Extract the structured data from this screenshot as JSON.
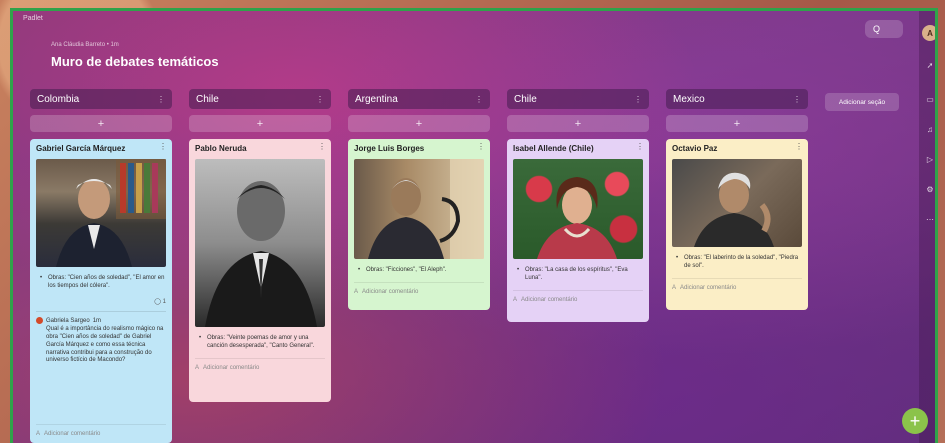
{
  "app": {
    "name": "Padlet"
  },
  "wall": {
    "author_line": "Ana Cláudia Barreto • 1m",
    "title": "Muro de debates temáticos"
  },
  "toolbar": {
    "search_label": "Q"
  },
  "add_section_label": "Adicionar seção",
  "add_post_symbol": "+",
  "comment_placeholder": "Adicionar comentário",
  "columns": [
    {
      "name": "Colombia",
      "card": {
        "title": "Gabriel García Márquez",
        "bullet": "Obras: \"Cien años de soledad\", \"El amor en los tiempos del cólera\".",
        "reaction_count": "1",
        "reply": {
          "author": "Gabriela Sargeo",
          "time": "1m",
          "text": "Qual é a importância do realismo mágico na obra \"Cien años de soledad\" de Gabriel García Márquez e como essa técnica narrativa contribui para a construção do universo fictício de Macondo?"
        }
      }
    },
    {
      "name": "Chile",
      "card": {
        "title": "Pablo Neruda",
        "bullet": "Obras: \"Veinte poemas de amor y una canción desesperada\", \"Canto General\"."
      }
    },
    {
      "name": "Argentina",
      "card": {
        "title": "Jorge Luis Borges",
        "bullet": "Obras: \"Ficciones\", \"El Aleph\"."
      }
    },
    {
      "name": "Chile",
      "card": {
        "title": "Isabel Allende (Chile)",
        "bullet": "Obras: \"La casa de los espíritus\", \"Eva Luna\"."
      }
    },
    {
      "name": "Mexico",
      "card": {
        "title": "Octavio Paz",
        "bullet": "Obras: \"El laberinto de la soledad\", \"Piedra de sol\"."
      }
    }
  ],
  "colors": {
    "card_blue": "#bfe6f7",
    "card_pink": "#f9d7dc",
    "card_green": "#d6f5cf",
    "card_purple": "#e5d2f6",
    "card_yellow": "#fbeec6",
    "frame_border": "#2fa24a",
    "fab": "#8bc34a"
  }
}
